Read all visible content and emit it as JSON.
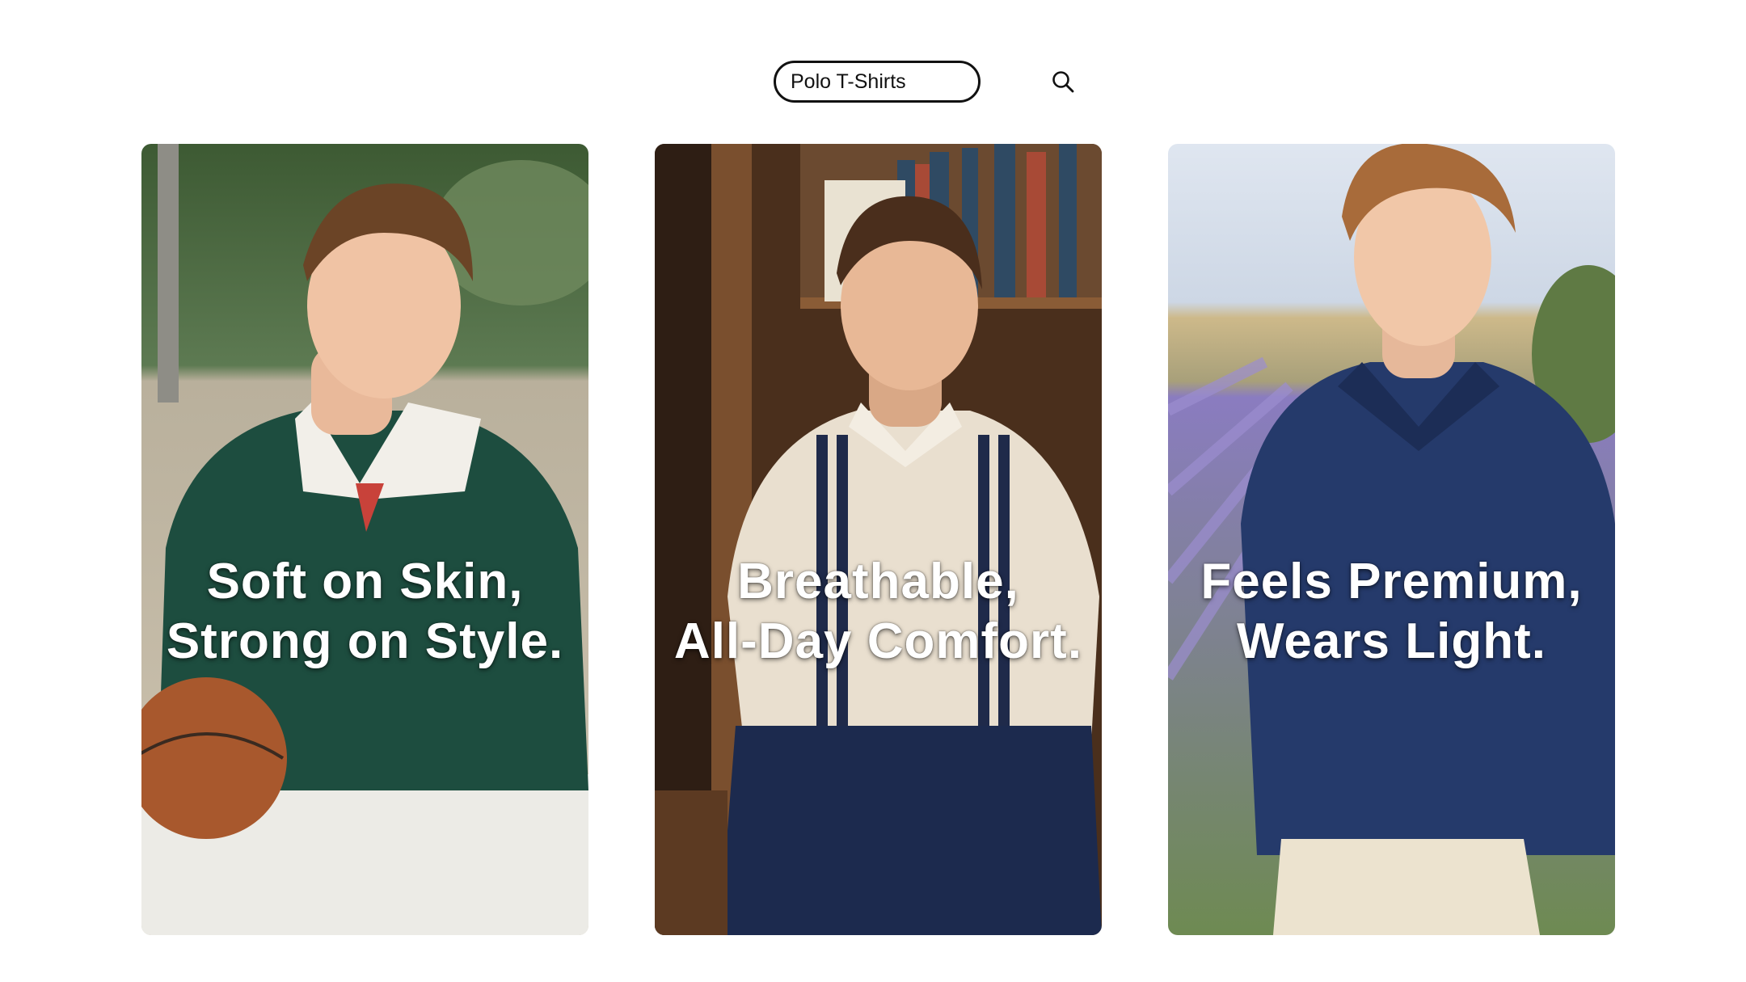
{
  "search": {
    "value": "Polo T-Shirts",
    "icon": "search-icon"
  },
  "cards": [
    {
      "line1": "Soft on Skin,",
      "line2": "Strong on Style.",
      "colors": {
        "shirt": "#1d4d3f",
        "collar": "#f2efe9",
        "background": "#7fa07a"
      }
    },
    {
      "line1": "Breathable,",
      "line2": "All-Day Comfort.",
      "colors": {
        "shirt": "#e9dfcf",
        "stripe": "#1f2a4a",
        "background": "#5a3a22"
      }
    },
    {
      "line1": "Feels Premium,",
      "line2": "Wears Light.",
      "colors": {
        "shirt": "#253a6b",
        "field": "#8a7cc0",
        "background": "#cfd8e6"
      }
    }
  ]
}
